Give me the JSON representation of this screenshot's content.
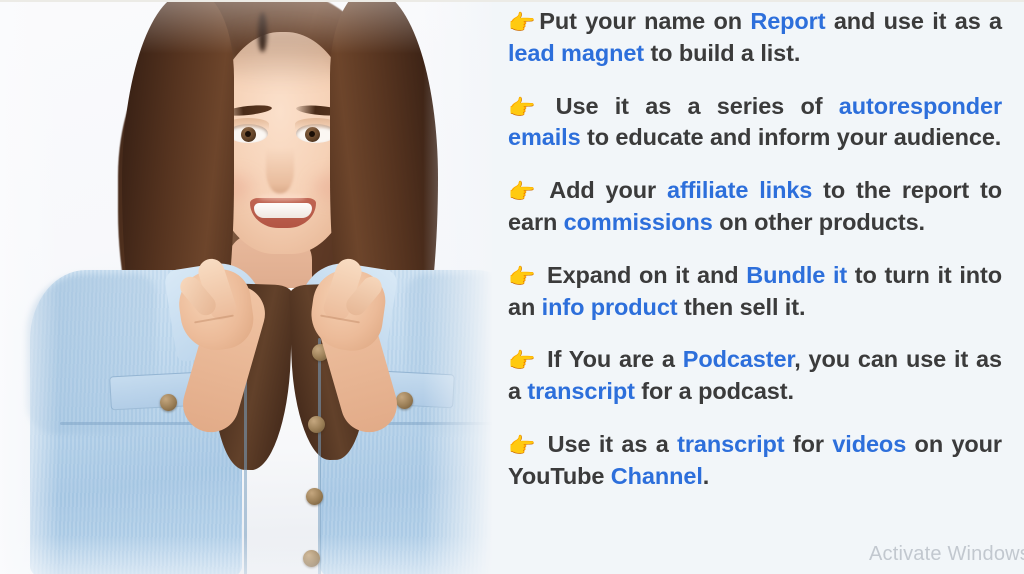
{
  "slide": {
    "background_color": "#f2f6f9",
    "accent_keyword_color": "#2d6fdb",
    "body_text_color": "#3b3b3b"
  },
  "photo": {
    "alt": "Smiling young woman with long brown hair wearing a light blue denim jacket over a white t-shirt, pointing forward with both index fingers",
    "subject": "young-woman-pointing",
    "jacket_color": "#bcd6ec",
    "hair_color": "#55331f",
    "shirt_color": "#ffffff"
  },
  "bullets": [
    {
      "icon": "pointing-right-hand",
      "icon_glyph": "👉",
      "segments": [
        {
          "text": "Put your name on ",
          "highlight": false
        },
        {
          "text": "Report",
          "highlight": true
        },
        {
          "text": " and use it as a ",
          "highlight": false
        },
        {
          "text": "lead magnet",
          "highlight": true
        },
        {
          "text": " to build a list.",
          "highlight": false
        }
      ]
    },
    {
      "icon": "pointing-right-hand",
      "icon_glyph": "👉",
      "segments": [
        {
          "text": " Use it as a series of ",
          "highlight": false
        },
        {
          "text": "autoresponder emails",
          "highlight": true
        },
        {
          "text": " to educate and inform your audience.",
          "highlight": false
        }
      ]
    },
    {
      "icon": "pointing-right-hand",
      "icon_glyph": "👉",
      "segments": [
        {
          "text": " Add your ",
          "highlight": false
        },
        {
          "text": "affiliate links",
          "highlight": true
        },
        {
          "text": " to the report to earn ",
          "highlight": false
        },
        {
          "text": "commissions",
          "highlight": true
        },
        {
          "text": " on other products.",
          "highlight": false
        }
      ]
    },
    {
      "icon": "pointing-right-hand",
      "icon_glyph": "👉",
      "segments": [
        {
          "text": " Expand on it and ",
          "highlight": false
        },
        {
          "text": "Bundle it",
          "highlight": true
        },
        {
          "text": " to turn it into an ",
          "highlight": false
        },
        {
          "text": "info product",
          "highlight": true
        },
        {
          "text": " then sell it.",
          "highlight": false
        }
      ]
    },
    {
      "icon": "pointing-right-hand",
      "icon_glyph": "👉",
      "segments": [
        {
          "text": " If You are a ",
          "highlight": false
        },
        {
          "text": "Podcaster",
          "highlight": true
        },
        {
          "text": ", you can use it as a ",
          "highlight": false
        },
        {
          "text": "transcript",
          "highlight": true
        },
        {
          "text": " for a podcast.",
          "highlight": false
        }
      ]
    },
    {
      "icon": "pointing-right-hand",
      "icon_glyph": "👉",
      "segments": [
        {
          "text": " Use it as a ",
          "highlight": false
        },
        {
          "text": "transcript",
          "highlight": true
        },
        {
          "text": " for ",
          "highlight": false
        },
        {
          "text": "videos",
          "highlight": true
        },
        {
          "text": " on your YouTube ",
          "highlight": false
        },
        {
          "text": "Channel",
          "highlight": true
        },
        {
          "text": ".",
          "highlight": false
        }
      ]
    }
  ],
  "watermark": {
    "text": "Activate Windows"
  }
}
